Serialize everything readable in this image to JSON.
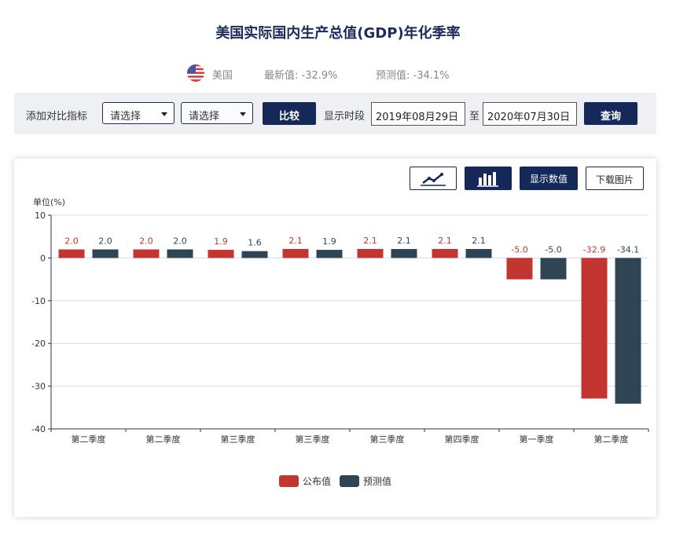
{
  "header": {
    "title": "美国实际国内生产总值(GDP)年化季率",
    "country": "美国",
    "latest": "最新值: -32.9%",
    "forecast": "预测值: -34.1%"
  },
  "toolbar": {
    "compare_label": "添加对比指标",
    "select1": "请选择",
    "select2": "请选择",
    "compare_button": "比较",
    "period_label": "显示时段",
    "start_date": "2019年08月29日",
    "to_label": "至",
    "end_date": "2020年07月30日",
    "query_button": "查询"
  },
  "chart_toolbar": {
    "line_icon": "line-chart-icon",
    "bar_icon": "bar-chart-icon",
    "show_values": "显示数值",
    "download": "下载图片"
  },
  "colors": {
    "published": "#c23531",
    "forecast": "#2f4554",
    "brand": "#14285a"
  },
  "chart_data": {
    "type": "bar",
    "unit_label": "单位(%)",
    "categories": [
      "第二季度",
      "第二季度",
      "第三季度",
      "第三季度",
      "第三季度",
      "第四季度",
      "第一季度",
      "第二季度"
    ],
    "series": [
      {
        "name": "公布值",
        "values": [
          2.0,
          2.0,
          1.9,
          2.1,
          2.1,
          2.1,
          -5.0,
          -32.9
        ]
      },
      {
        "name": "预测值",
        "values": [
          2.0,
          2.0,
          1.6,
          1.9,
          2.1,
          2.1,
          -5.0,
          -34.1
        ]
      }
    ],
    "value_labels": [
      [
        "2.0",
        "2.0",
        "1.9",
        "2.1",
        "2.1",
        "2.1",
        "-5.0",
        "-32.9"
      ],
      [
        "2.0",
        "2.0",
        "1.6",
        "1.9",
        "2.1",
        "2.1",
        "-5.0",
        "-34.1"
      ]
    ],
    "y_ticks": [
      "10",
      "0",
      "-10",
      "-20",
      "-30",
      "-40"
    ],
    "ylim": [
      -40,
      10
    ],
    "grid": true,
    "legend_position": "bottom-center"
  }
}
